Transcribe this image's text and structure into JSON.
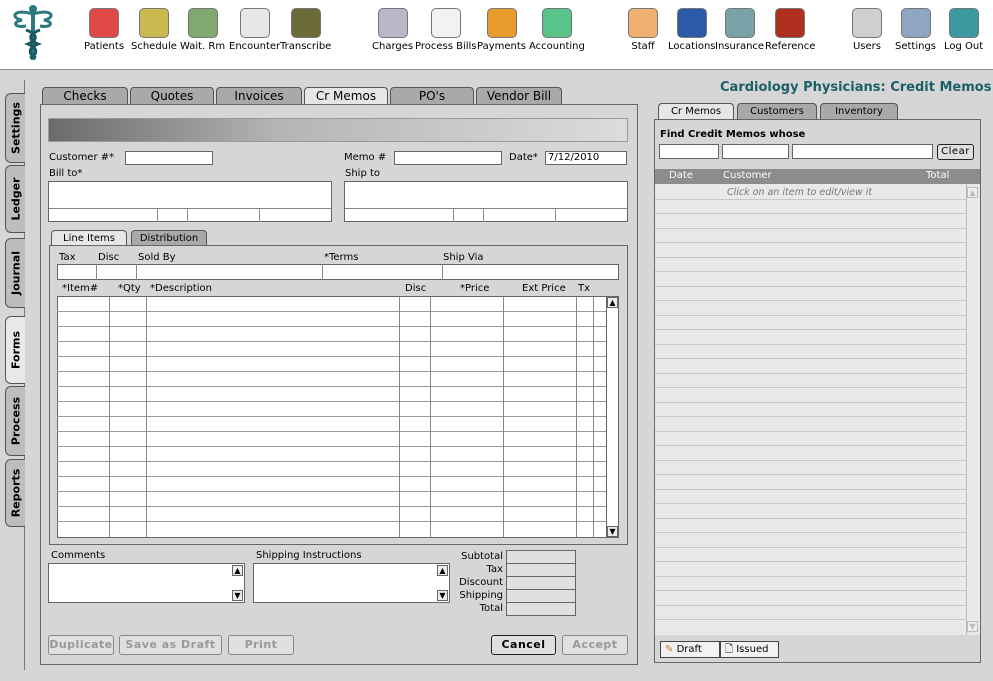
{
  "toolbar": {
    "items": [
      {
        "label": "Patients",
        "icon": "patients-icon",
        "color": "#e04848"
      },
      {
        "label": "Schedule",
        "icon": "calendar-icon",
        "color": "#c9b94f"
      },
      {
        "label": "Wait. Rm",
        "icon": "waiting-room-icon",
        "color": "#7fa96e"
      },
      {
        "label": "Encounter",
        "icon": "medical-kit-icon",
        "color": "#e7e7e7"
      },
      {
        "label": "Transcribe",
        "icon": "transcribe-icon",
        "color": "#6b6b3a"
      },
      {
        "label": "Charges",
        "icon": "calculator-icon",
        "color": "#b8b8c8"
      },
      {
        "label": "Process Bills",
        "icon": "bills-icon",
        "color": "#f2f2f2"
      },
      {
        "label": "Payments",
        "icon": "payments-icon",
        "color": "#e89a2c"
      },
      {
        "label": "Accounting",
        "icon": "accounting-icon",
        "color": "#59c48a"
      },
      {
        "label": "Staff",
        "icon": "nurse-icon",
        "color": "#f0b070"
      },
      {
        "label": "Locations",
        "icon": "locations-icon",
        "color": "#2b5aa8"
      },
      {
        "label": "Insurance",
        "icon": "insurance-icon",
        "color": "#7aa0a8"
      },
      {
        "label": "Reference",
        "icon": "reference-book-icon",
        "color": "#b03020"
      },
      {
        "label": "Users",
        "icon": "users-icon",
        "color": "#cfcfcf"
      },
      {
        "label": "Settings",
        "icon": "settings-icon",
        "color": "#8fa6c2"
      },
      {
        "label": "Log Out",
        "icon": "logout-icon",
        "color": "#3a9aa0"
      }
    ]
  },
  "side_tabs": [
    "Settings",
    "Ledger",
    "Journal",
    "Forms",
    "Process",
    "Reports"
  ],
  "form_tabs": [
    "Checks",
    "Quotes",
    "Invoices",
    "Cr Memos",
    "PO's",
    "Vendor Bill"
  ],
  "page_title": "Cardiology Physicians:  Credit Memos",
  "form": {
    "customer_label": "Customer #*",
    "memo_label": "Memo #",
    "date_label": "Date*",
    "date_value": "7/12/2010",
    "bill_to_label": "Bill to*",
    "ship_to_label": "Ship to"
  },
  "sub_tabs": [
    "Line Items",
    "Distribution"
  ],
  "terms_headers": {
    "tax": "Tax",
    "disc": "Disc",
    "sold_by": "Sold By",
    "terms": "*Terms",
    "ship_via": "Ship Via"
  },
  "line_headers": {
    "item": "*Item#",
    "qty": "*Qty",
    "description": "*Description",
    "disc": "Disc",
    "price": "*Price",
    "ext_price": "Ext Price",
    "tx": "Tx"
  },
  "bottom": {
    "comments_label": "Comments",
    "shipping_label": "Shipping Instructions",
    "totals": [
      "Subtotal",
      "Tax",
      "Discount",
      "Shipping",
      "Total"
    ]
  },
  "buttons": {
    "duplicate": "Duplicate",
    "save_draft": "Save as Draft",
    "print": "Print",
    "cancel": "Cancel",
    "accept": "Accept"
  },
  "right": {
    "tabs": [
      "Cr Memos",
      "Customers",
      "Inventory"
    ],
    "find_label": "Find Credit Memos whose",
    "clear": "Clear",
    "columns": {
      "date": "Date",
      "customer": "Customer",
      "total": "Total"
    },
    "hint": "Click on an item to edit/view it",
    "status": {
      "draft": "Draft",
      "issued": "Issued"
    }
  },
  "colors": {
    "title": "#1d5f66",
    "logo": "#2a7a80"
  }
}
